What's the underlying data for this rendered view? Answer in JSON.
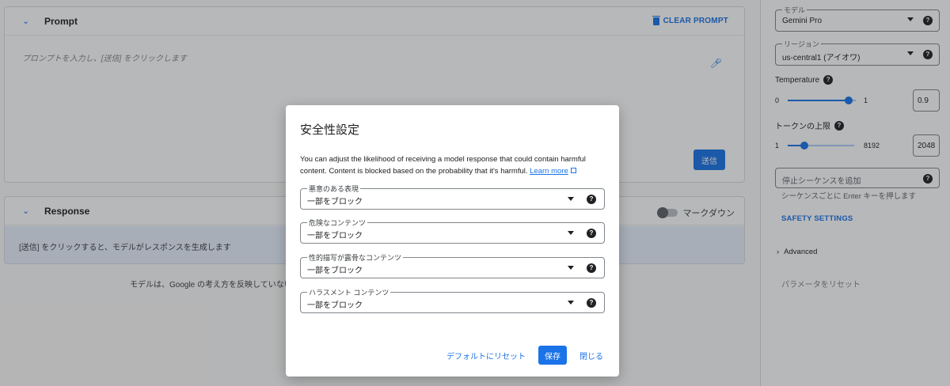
{
  "prompt": {
    "title": "Prompt",
    "clear_label": "CLEAR PROMPT",
    "placeholder": "プロンプトを入力し、[送信] をクリックします",
    "send_label": "送信"
  },
  "response": {
    "title": "Response",
    "markdown_label": "マークダウン",
    "body": "[送信] をクリックすると、モデルがレスポンスを生成します"
  },
  "disclaimer": "モデルは、Google の考え方を反映していない、不",
  "sidebar": {
    "model": {
      "label": "モデル",
      "value": "Gemini Pro"
    },
    "region": {
      "label": "リージョン",
      "value": "us-central1 (アイオワ)"
    },
    "temperature": {
      "label": "Temperature",
      "min": "0",
      "max": "1",
      "value": "0.9",
      "fraction": 0.9
    },
    "tokens": {
      "label": "トークンの上限",
      "min": "1",
      "max": "8192",
      "value": "2048",
      "fraction": 0.25
    },
    "stop_placeholder": "停止シーケンスを追加",
    "stop_hint": "シーケンスごとに Enter キーを押します",
    "safety_settings": "SAFETY SETTINGS",
    "advanced": "Advanced",
    "reset_params": "パラメータをリセット"
  },
  "dialog": {
    "title": "安全性設定",
    "description": "You can adjust the likelihood of receiving a model response that could contain harmful content. Content is blocked based on the probability that it's harmful.",
    "learn_more": "Learn more",
    "fields": [
      {
        "label": "悪意のある表現",
        "value": "一部をブロック"
      },
      {
        "label": "危険なコンテンツ",
        "value": "一部をブロック"
      },
      {
        "label": "性的描写が露骨なコンテンツ",
        "value": "一部をブロック"
      },
      {
        "label": "ハラスメント コンテンツ",
        "value": "一部をブロック"
      }
    ],
    "reset_default": "デフォルトにリセット",
    "save": "保存",
    "close": "閉じる"
  },
  "colors": {
    "accent": "#1a73e8",
    "response_bg": "#e8f0fe"
  }
}
